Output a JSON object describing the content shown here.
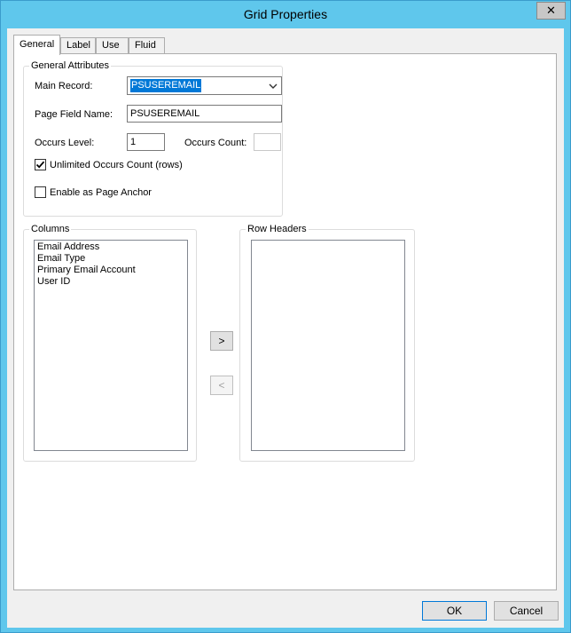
{
  "window": {
    "title": "Grid Properties",
    "close_label": "✕"
  },
  "tabs": [
    {
      "label": "General",
      "active": true
    },
    {
      "label": "Label",
      "active": false
    },
    {
      "label": "Use",
      "active": false
    },
    {
      "label": "Fluid",
      "active": false
    }
  ],
  "general_attributes": {
    "group_label": "General Attributes",
    "main_record_label": "Main Record:",
    "main_record_value": "PSUSEREMAIL",
    "page_field_name_label": "Page Field Name:",
    "page_field_name_value": "PSUSEREMAIL",
    "occurs_level_label": "Occurs Level:",
    "occurs_level_value": "1",
    "occurs_count_label": "Occurs Count:",
    "occurs_count_value": "",
    "unlimited_label": "Unlimited Occurs Count (rows)",
    "unlimited_checked": true,
    "page_anchor_label": "Enable as Page Anchor",
    "page_anchor_checked": false
  },
  "columns": {
    "group_label": "Columns",
    "items": [
      "Email Address",
      "Email Type",
      "Primary Email Account",
      "User ID"
    ]
  },
  "row_headers": {
    "group_label": "Row Headers",
    "items": []
  },
  "move_buttons": {
    "right_label": ">",
    "left_label": "<"
  },
  "footer": {
    "ok_label": "OK",
    "cancel_label": "Cancel"
  }
}
